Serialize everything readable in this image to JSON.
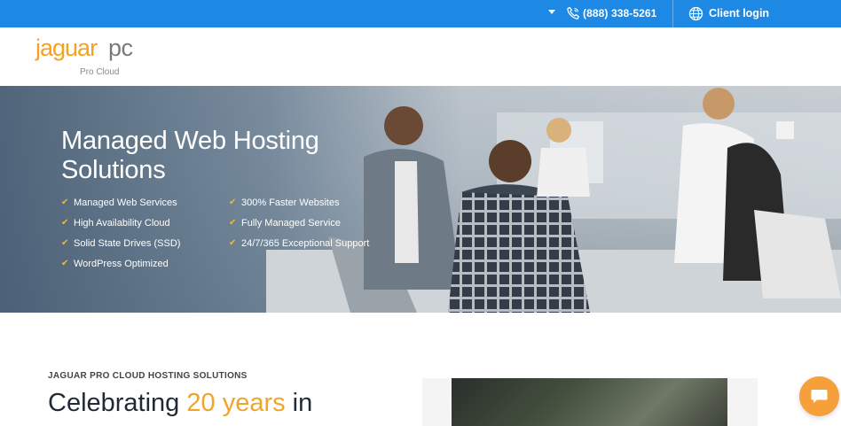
{
  "topbar": {
    "phone": "(888) 338-5261",
    "client_login": "Client login",
    "icons": [
      "caret-down-icon",
      "phone-icon",
      "globe-icon"
    ]
  },
  "logo": {
    "brand_primary": "jaguar",
    "brand_secondary": "pc",
    "tagline": "Pro Cloud"
  },
  "hero": {
    "title": "Managed Web Hosting Solutions",
    "features_left": [
      "Managed Web Services",
      "High Availability Cloud",
      "Solid State Drives (SSD)",
      "WordPress Optimized"
    ],
    "features_right": [
      "300% Faster Websites",
      "Fully Managed Service",
      "24/7/365 Exceptional Support"
    ],
    "check_glyph": "✔"
  },
  "content": {
    "label": "JAGUAR PRO CLOUD HOSTING SOLUTIONS",
    "heading_start": "Celebrating ",
    "heading_accent": "20 years",
    "heading_end": " in"
  },
  "colors": {
    "topbar": "#1e88e5",
    "brand_orange": "#f7a21b",
    "accent": "#f0a52a",
    "chat": "#f6a03c"
  }
}
